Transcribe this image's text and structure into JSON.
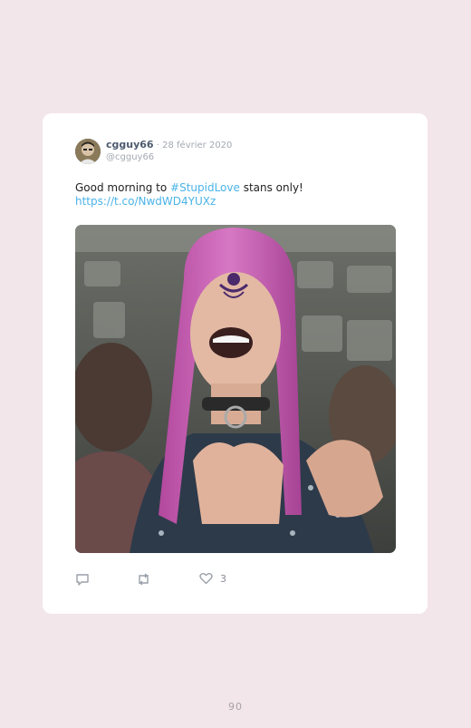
{
  "tweet": {
    "username": "cgguy66",
    "separator": " · ",
    "date": "28 février 2020",
    "handle": "@cgguy66",
    "text_before": "Good morning to ",
    "hashtag": "#StupidLove",
    "text_after": " stans only!",
    "link": "https://t.co/NwdWD4YUXz",
    "like_count": "3"
  },
  "page": {
    "number": "90"
  },
  "icons": {
    "avatar": "avatar-photo",
    "reply": "reply-icon",
    "retweet": "retweet-icon",
    "like": "heart-icon"
  },
  "colors": {
    "background": "#f3e6ea",
    "card": "#ffffff",
    "link": "#4ab3e8",
    "icon": "#9aa0a8"
  }
}
